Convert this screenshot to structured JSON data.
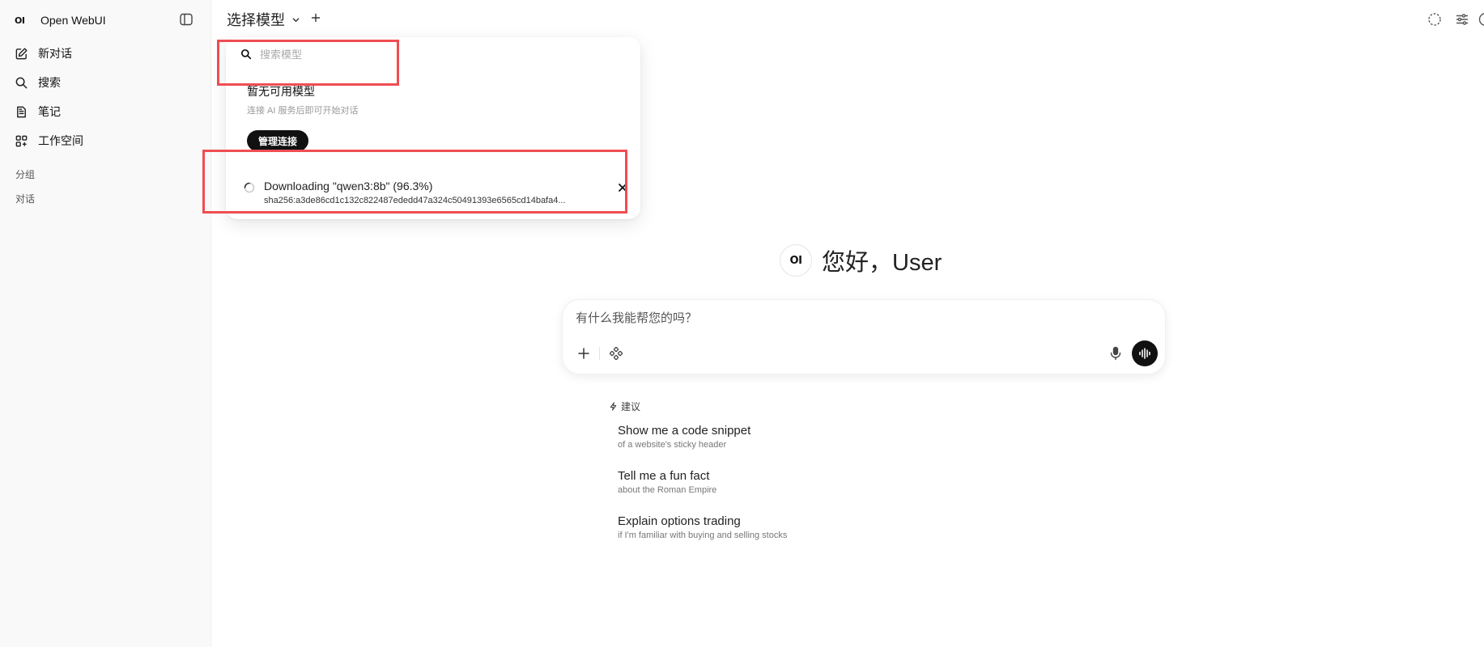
{
  "sidebar": {
    "logo_mark": "OI",
    "app_name": "Open WebUI",
    "items": [
      {
        "label": "新对话",
        "icon": "edit-icon"
      },
      {
        "label": "搜索",
        "icon": "search-icon"
      },
      {
        "label": "笔记",
        "icon": "notes-icon"
      },
      {
        "label": "工作空间",
        "icon": "workspace-icon"
      }
    ],
    "section_groups": "分组",
    "section_chats": "对话"
  },
  "header": {
    "model_select_label": "选择模型"
  },
  "model_dropdown": {
    "search_placeholder": "搜索模型",
    "empty_title": "暂无可用模型",
    "empty_subtitle": "连接 AI 服务后即可开始对话",
    "manage_button": "管理连接",
    "download": {
      "title": "Downloading \"qwen3:8b\" (96.3%)",
      "hash": "sha256:a3de86cd1c132c822487ededd47a324c50491393e6565cd14bafa4..."
    }
  },
  "greeting": {
    "logo_mark": "OI",
    "text": "您好，User"
  },
  "composer": {
    "placeholder": "有什么我能帮您的吗？"
  },
  "suggestions": {
    "header": "建议",
    "items": [
      {
        "title": "Show me a code snippet",
        "subtitle": "of a website's sticky header"
      },
      {
        "title": "Tell me a fun fact",
        "subtitle": "about the Roman Empire"
      },
      {
        "title": "Explain options trading",
        "subtitle": "if I'm familiar with buying and selling stocks"
      }
    ]
  },
  "colors": {
    "highlight": "#ef4d52",
    "sidebar_bg": "#f9f9f9",
    "button_dark": "#111111"
  }
}
